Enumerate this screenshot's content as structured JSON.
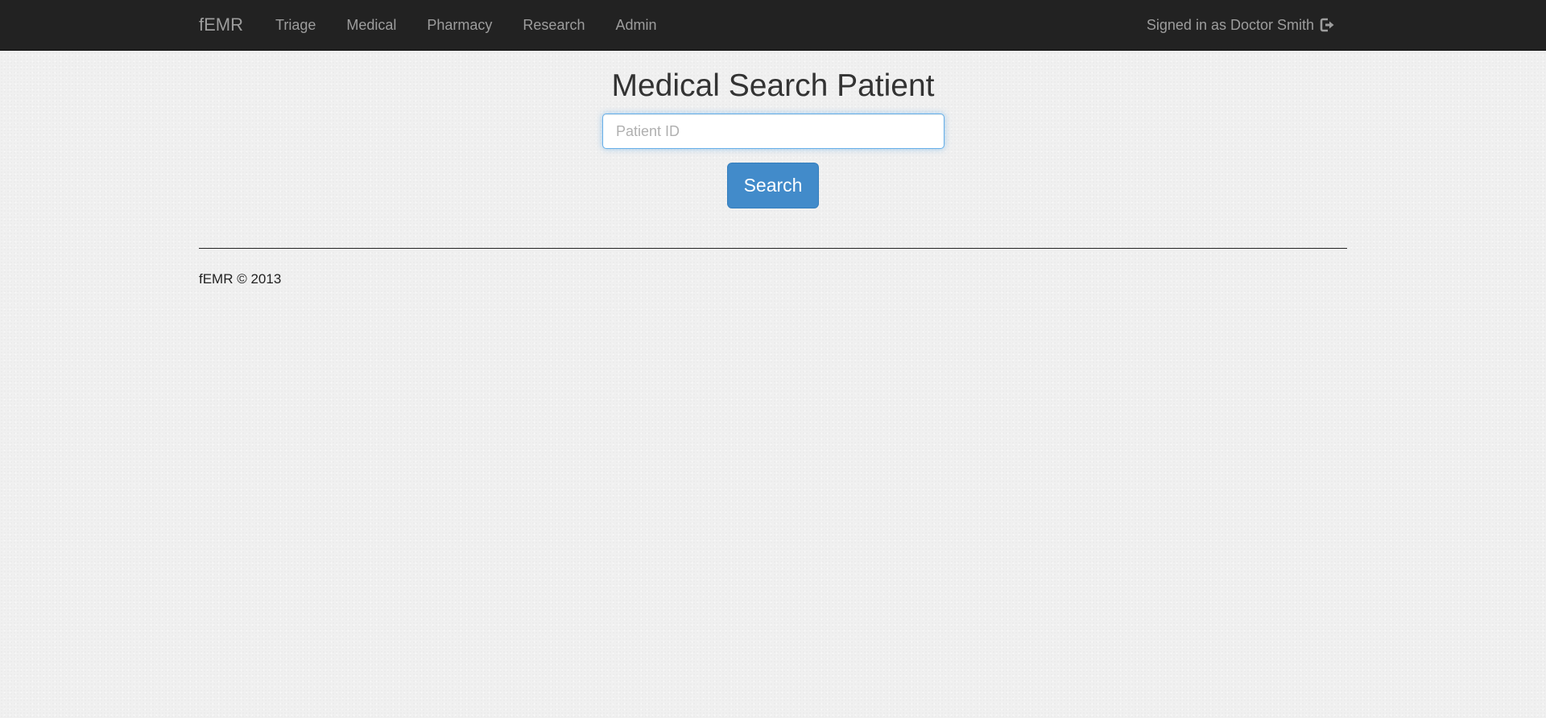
{
  "navbar": {
    "brand": "fEMR",
    "items": [
      {
        "label": "Triage"
      },
      {
        "label": "Medical"
      },
      {
        "label": "Pharmacy"
      },
      {
        "label": "Research"
      },
      {
        "label": "Admin"
      }
    ],
    "signed_in_text": "Signed in as Doctor Smith",
    "signout_icon": "sign-out-icon",
    "background": "#222222",
    "text_color": "#9d9d9d"
  },
  "main": {
    "title": "Medical Search Patient",
    "search": {
      "placeholder": "Patient ID",
      "value": ""
    },
    "search_button_label": "Search",
    "accent": "#428bca"
  },
  "footer": {
    "text": "fEMR © 2013"
  }
}
